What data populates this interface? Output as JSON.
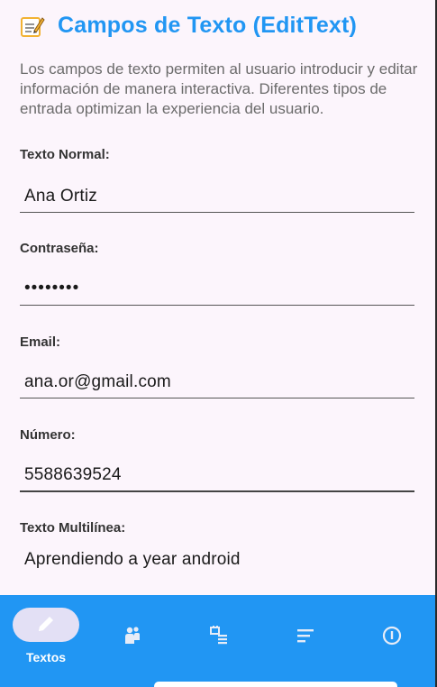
{
  "header": {
    "icon": "memo-icon",
    "title": "Campos de Texto (EditText)"
  },
  "description": "Los campos de texto permiten al usuario introducir y editar información de manera interactiva. Diferentes tipos de entrada optimizan la experiencia del usuario.",
  "fields": [
    {
      "label": "Texto Normal:",
      "value": "Ana Ortiz"
    },
    {
      "label": "Contraseña:",
      "value": "••••••••"
    },
    {
      "label": "Email:",
      "value": "ana.or@gmail.com"
    },
    {
      "label": "Número:",
      "value": "5588639524"
    },
    {
      "label": "Texto Multilínea:",
      "value": "Aprendiendo a year android"
    }
  ],
  "bottom_nav": {
    "active_label": "Textos",
    "items": [
      {
        "icon": "pencil-icon",
        "label": "Textos",
        "active": true
      },
      {
        "icon": "people-icon",
        "active": false
      },
      {
        "icon": "checklist-icon",
        "active": false
      },
      {
        "icon": "sort-lines-icon",
        "active": false
      },
      {
        "icon": "info-icon",
        "active": false
      }
    ]
  },
  "colors": {
    "accent": "#2196f3",
    "background": "#fcf5fc",
    "active_pill": "#e3e0f5"
  }
}
